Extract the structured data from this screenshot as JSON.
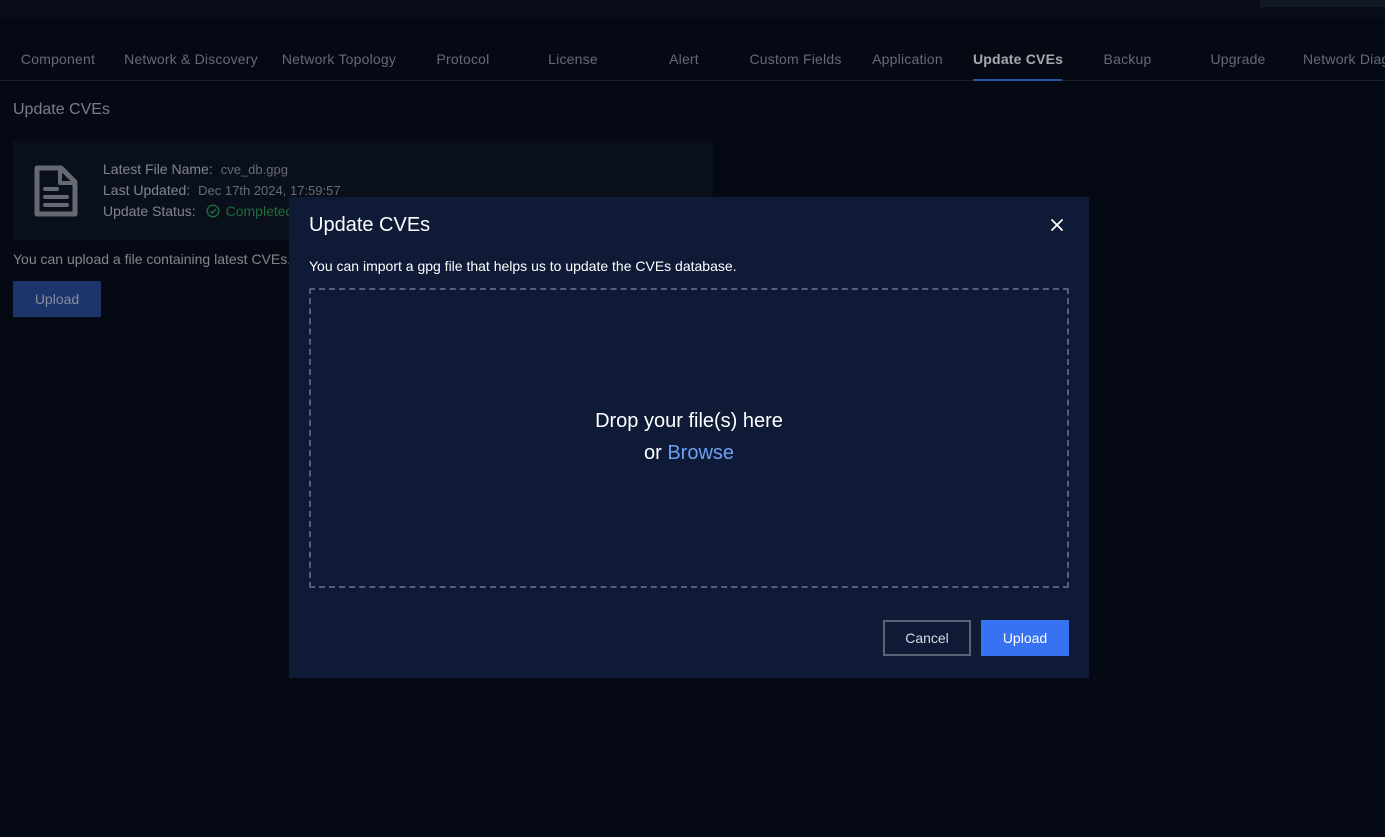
{
  "tabs": [
    {
      "label": "Component"
    },
    {
      "label": "Network & Discovery"
    },
    {
      "label": "Network Topology"
    },
    {
      "label": "Protocol"
    },
    {
      "label": "License"
    },
    {
      "label": "Alert"
    },
    {
      "label": "Custom Fields"
    },
    {
      "label": "Application"
    },
    {
      "label": "Update CVEs",
      "active": true
    },
    {
      "label": "Backup"
    },
    {
      "label": "Upgrade"
    },
    {
      "label": "Network Diag"
    }
  ],
  "page": {
    "title": "Update CVEs",
    "card": {
      "file_name_label": "Latest File Name:",
      "file_name_value": "cve_db.gpg",
      "updated_label": "Last Updated:",
      "updated_value": "Dec 17th 2024, 17:59:57",
      "status_label": "Update Status:",
      "status_value": "Completed"
    },
    "hint": "You can upload a file containing latest CVEs.",
    "upload_label": "Upload"
  },
  "modal": {
    "title": "Update CVEs",
    "subtitle": "You can import a gpg file that helps us to update the CVEs database.",
    "drop_text": "Drop your file(s) here",
    "or_text": "or",
    "browse_text": "Browse",
    "cancel_label": "Cancel",
    "upload_label": "Upload"
  },
  "colors": {
    "accent": "#3672f2",
    "status_ok": "#2fa44f",
    "link": "#6e9ff7"
  },
  "icons": [
    "document-icon",
    "check-circle-icon",
    "close-icon"
  ]
}
